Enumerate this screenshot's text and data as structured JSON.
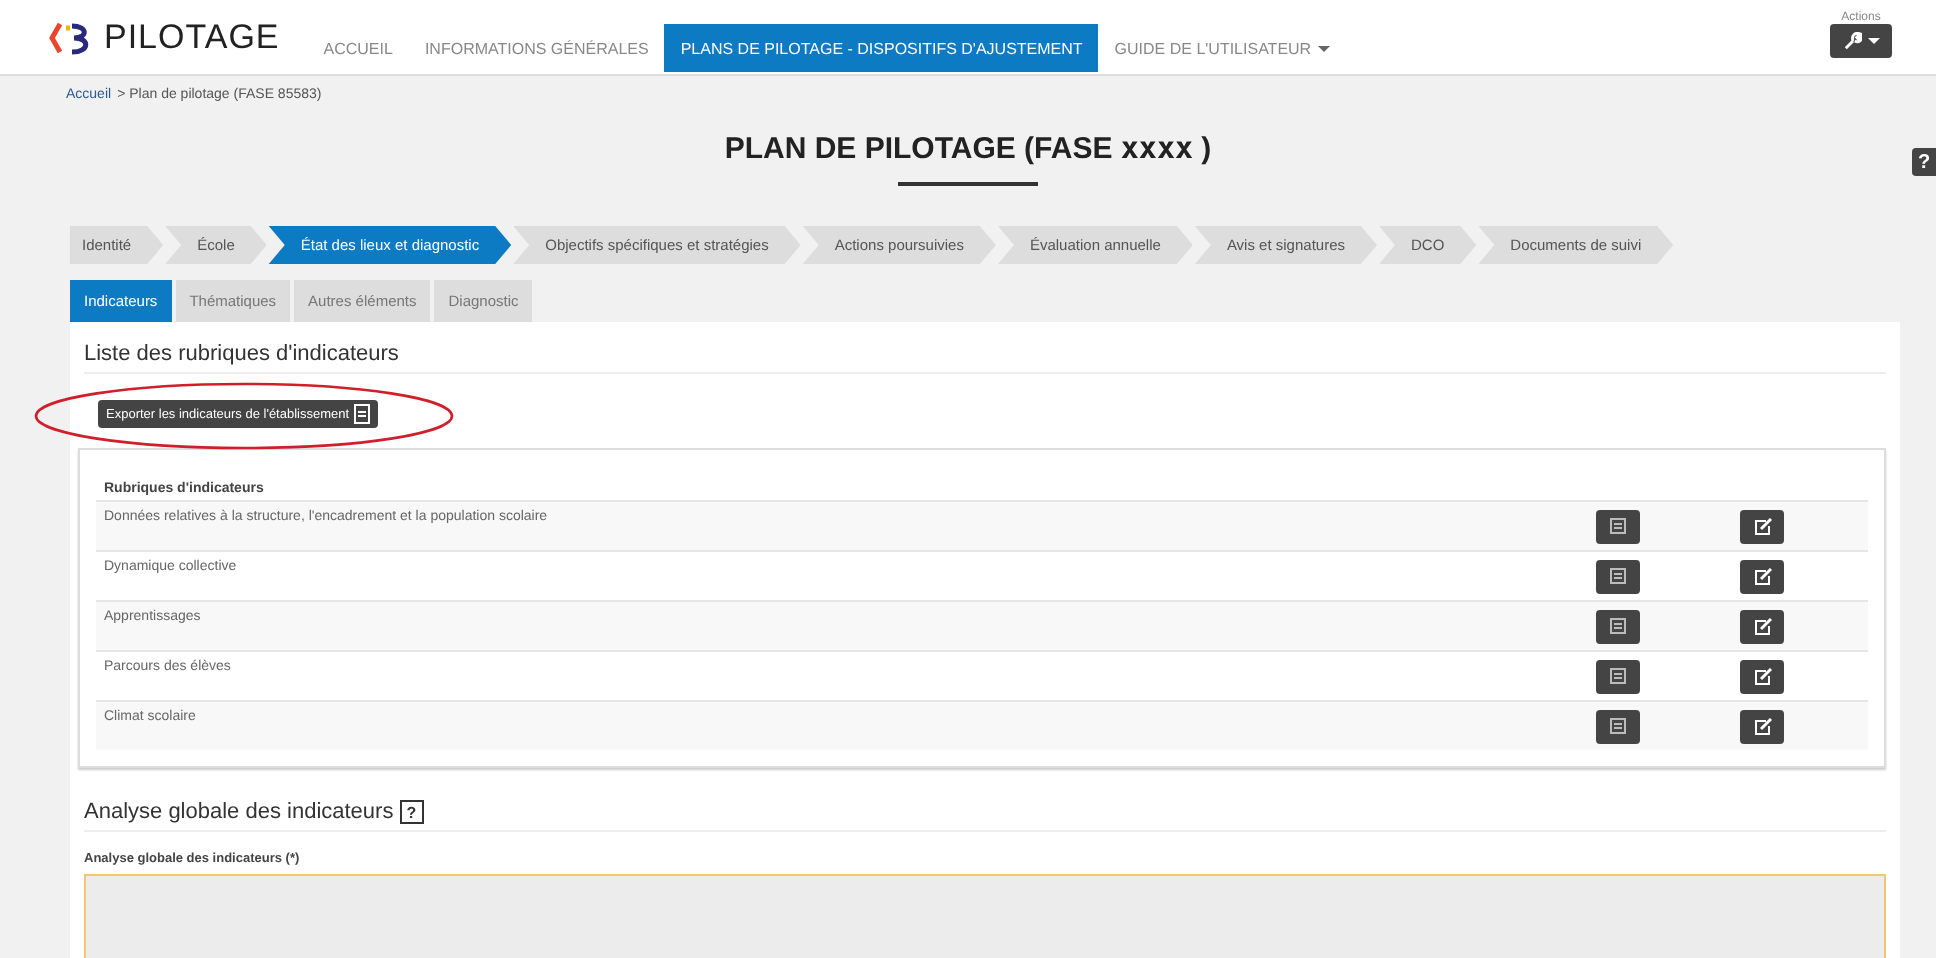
{
  "brand": {
    "name": "PILOTAGE"
  },
  "nav": [
    {
      "label": "ACCUEIL",
      "selected": false,
      "dropdown": false
    },
    {
      "label": "INFORMATIONS GÉNÉRALES",
      "selected": false,
      "dropdown": false
    },
    {
      "label": "PLANS DE PILOTAGE - DISPOSITIFS D'AJUSTEMENT",
      "selected": true,
      "dropdown": false
    },
    {
      "label": "GUIDE DE L'UTILISATEUR",
      "selected": false,
      "dropdown": true
    }
  ],
  "actions": {
    "label": "Actions"
  },
  "breadcrumb": [
    {
      "label": "Accueil",
      "link": true
    },
    {
      "label": "> Plan de pilotage (FASE 85583)",
      "link": false
    }
  ],
  "page_title": {
    "text": "PLAN DE PILOTAGE (FASE ",
    "code": "xxxx",
    "suffix": " )"
  },
  "steps": [
    {
      "label": "Identité",
      "selected": false
    },
    {
      "label": "École",
      "selected": false
    },
    {
      "label": "État des lieux et diagnostic",
      "selected": true
    },
    {
      "label": "Objectifs spécifiques et stratégies",
      "selected": false
    },
    {
      "label": "Actions poursuivies",
      "selected": false
    },
    {
      "label": "Évaluation annuelle",
      "selected": false
    },
    {
      "label": "Avis et signatures",
      "selected": false
    },
    {
      "label": "DCO",
      "selected": false
    },
    {
      "label": "Documents de suivi",
      "selected": false
    }
  ],
  "subtabs": [
    {
      "label": "Indicateurs",
      "selected": true
    },
    {
      "label": "Thématiques",
      "selected": false
    },
    {
      "label": "Autres éléments",
      "selected": false
    },
    {
      "label": "Diagnostic",
      "selected": false
    }
  ],
  "section_title": "Liste des rubriques d'indicateurs",
  "export_button": "Exporter les indicateurs de l'établissement",
  "table": {
    "heading": "Rubriques d'indicateurs",
    "rows": [
      "Données relatives à la structure, l'encadrement et la population scolaire",
      "Dynamique collective",
      "Apprentissages",
      "Parcours des élèves",
      "Climat scolaire"
    ]
  },
  "analysis": {
    "title": "Analyse globale des indicateurs",
    "help": "?",
    "field_label": "Analyse globale des indicateurs (*)"
  }
}
